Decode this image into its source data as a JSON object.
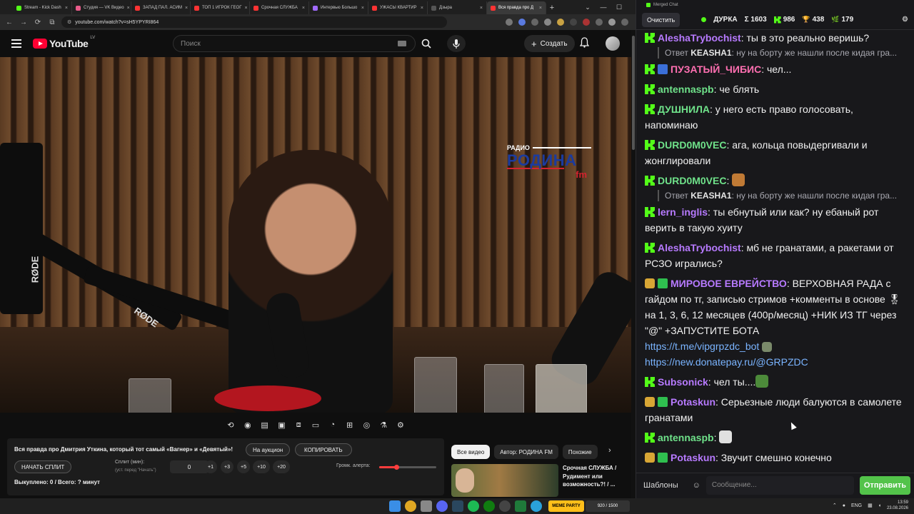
{
  "browser": {
    "tabs": [
      {
        "label": "Stream - Kick Dash",
        "color": "#53fc18"
      },
      {
        "label": "Студия — VK Видео",
        "color": "#e85b8a"
      },
      {
        "label": "ЗАПАД ПАЛ. АСИМ",
        "color": "#ff3333"
      },
      {
        "label": "ТОП 1 ИГРОК ГЕОГ",
        "color": "#ff3333"
      },
      {
        "label": "Срочная СЛУЖБА",
        "color": "#ff3333"
      },
      {
        "label": "Интервью Большо",
        "color": "#a06aff"
      },
      {
        "label": "УЖАСЫ КВАРТИР",
        "color": "#ff3333"
      },
      {
        "label": "Дзыра",
        "color": "#555555"
      },
      {
        "label": "Вся правда про Д",
        "color": "#ff3333",
        "active": true
      }
    ],
    "url": "youtube.com/watch?v=sH5YPYRI864"
  },
  "youtube": {
    "region": "LV",
    "logo_word": "YouTube",
    "search_placeholder": "Поиск",
    "create_label": "Создать"
  },
  "video": {
    "radio_top": "РАДИО",
    "radio_name": "РОДИНА",
    "radio_fm": "fm",
    "rode_label": "RØDE"
  },
  "split": {
    "title": "Вся правда про Дмитрия Уткина, который тот самый «Вагнер» и «Девятый»!",
    "auction_label": "На аукцион",
    "copy_label": "КОПИРОВАТЬ",
    "start_label": "НАЧАТЬ СПЛИТ",
    "split_min_label": "Сплит (мин):",
    "split_min_hint": "(уст. перед \"Начать\")",
    "split_min_value": "0",
    "steps": [
      "+1",
      "+3",
      "+5",
      "+10",
      "+20"
    ],
    "alert_label": "Громк. алерта:",
    "alert_volume": 0.3,
    "stats": "Выкуплено: 0 / Всего: ? минут"
  },
  "related": {
    "chips": [
      "Все видео",
      "Автор: РОДИНА FM",
      "Похожие"
    ],
    "title": "Срочная СЛУЖБА / Рудимент или возможность?! / ..."
  },
  "chat": {
    "window_title": "Merged Chat",
    "clear_label": "Очистить",
    "channel": "ДУРКА",
    "stat_total": "Σ 1603",
    "stat_kick": "986",
    "stat_a": "438",
    "stat_b": "179",
    "messages": [
      {
        "badge": "kick",
        "user": "AleshaTrybochist",
        "color": "#b77aff",
        "text": ": ты в это реально веришь?"
      },
      {
        "reply": true,
        "prefix": "Ответ ",
        "user": "KEASHA1",
        "text": ": ну на борту же нашли после кидая гра..."
      },
      {
        "badge": "kick",
        "badge2": "vip",
        "user": "ПУЗАТЫЙ_ЧИБИС",
        "color": "#ff6fb1",
        "text": ": чел..."
      },
      {
        "badge": "kick",
        "user": "antennaspb",
        "color": "#6fe28a",
        "text": ": че блять"
      },
      {
        "badge": "kick",
        "user": "ДУШНИЛА",
        "color": "#6fe28a",
        "text": ": у него есть право голосовать, напоминаю"
      },
      {
        "badge": "kick",
        "user": "DURD0M0VEC",
        "color": "#6fe28a",
        "text": ": ага, кольца повыдергивали и жонглировали"
      },
      {
        "badge": "kick",
        "user": "DURD0M0VEC",
        "color": "#6fe28a",
        "text": ": ",
        "emote": "#c07a35"
      },
      {
        "reply": true,
        "prefix": "Ответ ",
        "user": "KEASHA1",
        "text": ": ну на борту же нашли после кидая гра..."
      },
      {
        "badge": "kick",
        "user": "lern_inglis",
        "color": "#b77aff",
        "text": ": ты ебнутый или как? ну ебаный рот верить в такую хуиту"
      },
      {
        "badge": "kick",
        "user": "AleshaTrybochist",
        "color": "#b77aff",
        "text": ": мб не гранатами, а ракетами от РСЗО игрались?"
      },
      {
        "badge": "crown",
        "badge2": "check",
        "user": "МИРОВОЕ ЕВРЕЙСТВО",
        "color": "#b77aff",
        "text": ": ВЕРХОВНАЯ РАДА с гайдом по тг, записью стримов +комменты в основе 🎖 на 1, 3, 6, 12 месяцев (400р/месяц) +НИК ИЗ ТГ через \"@\" +ЗАПУСТИТЕ БОТА",
        "link1": "https://t.me/vipgrpzdc_bot",
        "link2": "https://new.donatepay.ru/@GRPZDC"
      },
      {
        "badge": "kick",
        "user": "Subsonick",
        "color": "#b77aff",
        "text": ": чел ты....",
        "emote": "#4c8a3a"
      },
      {
        "badge": "crown",
        "badge2": "check",
        "user": "Potaskun",
        "color": "#b77aff",
        "text": ": Серьезные люди балуются в самолете гранатами"
      },
      {
        "badge": "kick",
        "user": "antennaspb",
        "color": "#6fe28a",
        "text": ": ",
        "emote": "#e0e0e0"
      },
      {
        "badge": "crown",
        "badge2": "check",
        "user": "Potaskun",
        "color": "#b77aff",
        "text": ": Звучит смешно конечно"
      }
    ],
    "templates_label": "Шаблоны",
    "input_placeholder": "Сообщение...",
    "send_label": "Отправить"
  },
  "taskbar": {
    "meme_label": "MEME PARTY",
    "meme_count": "920 / 1500",
    "lang": "ENG",
    "time": "13:59",
    "date": "23.08.2026"
  }
}
